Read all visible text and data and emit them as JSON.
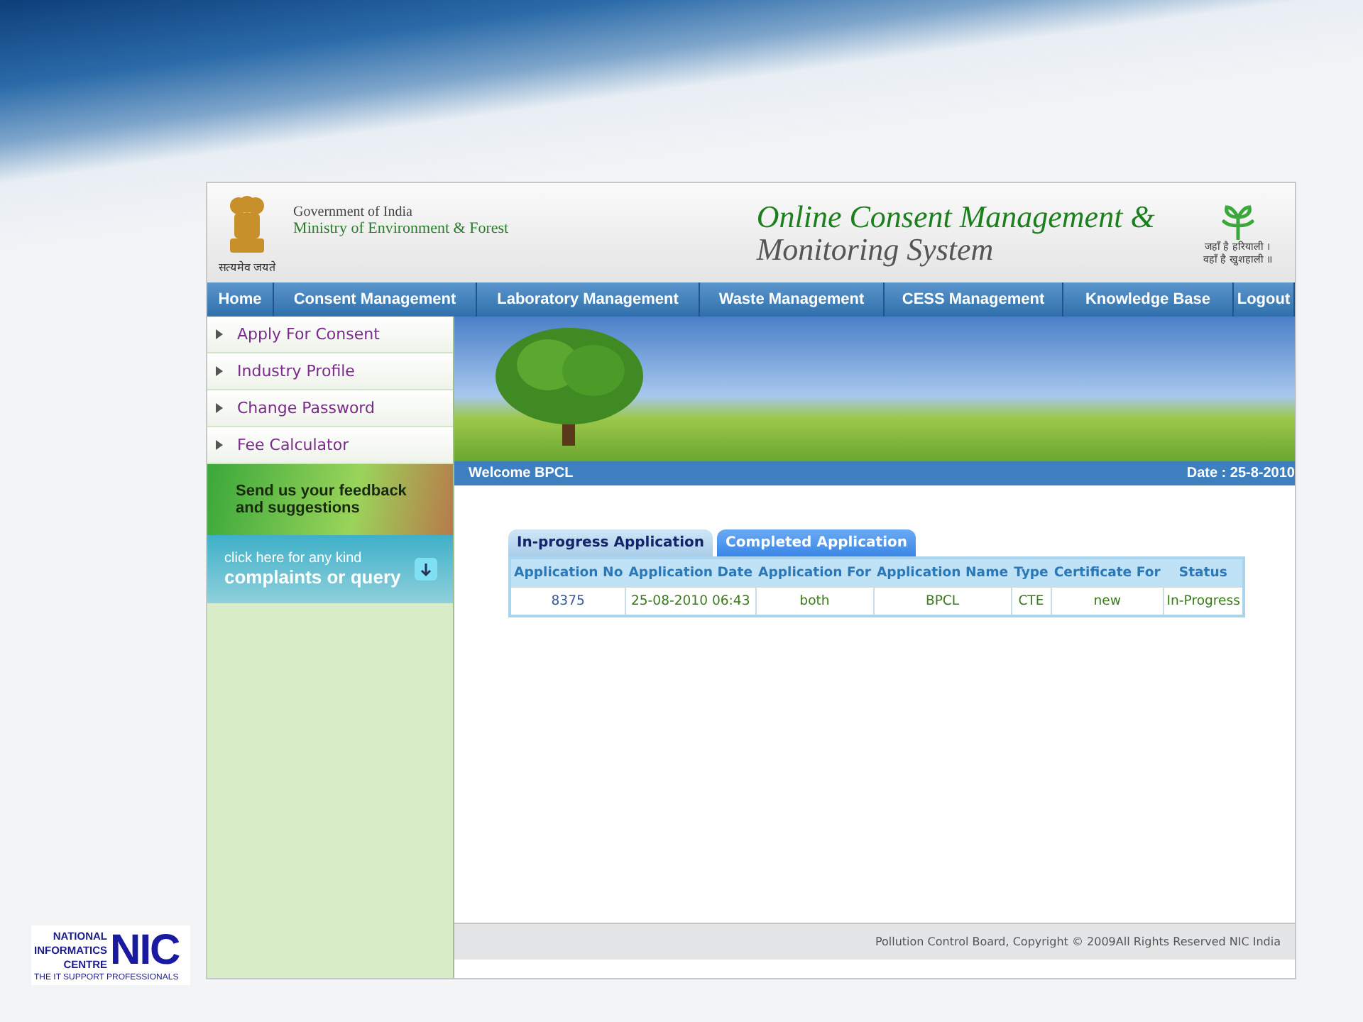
{
  "header": {
    "emblem_caption": "सत्यमेव जयते",
    "government": "Government of India",
    "ministry": "Ministry of Environment & Forest",
    "title_line1": "Online Consent Management &",
    "title_line2": "Monitoring System",
    "slogan_line1": "जहाँ है हरियाली ।",
    "slogan_line2": "वहाँ है खुशहाली ॥"
  },
  "nav": [
    "Home",
    "Consent Management",
    "Laboratory Management",
    "Waste Management",
    "CESS Management",
    "Knowledge Base",
    "Logout"
  ],
  "sidebar": {
    "items": [
      "Apply For Consent",
      "Industry Profile",
      "Change Password",
      "Fee Calculator"
    ],
    "feedback_banner": {
      "line1": "Send us your feedback",
      "line2": "and suggestions"
    },
    "complaints_banner": {
      "line1": "click here for any kind",
      "line2": "complaints or query"
    }
  },
  "welcome": "Welcome BPCL",
  "date": "Date : 25-8-2010",
  "tabs": [
    {
      "label": "In-progress Application",
      "selected": false
    },
    {
      "label": "Completed Application",
      "selected": true
    }
  ],
  "table": {
    "columns": [
      "Application No",
      "Application Date",
      "Application For",
      "Application Name",
      "Type",
      "Certificate For",
      "Status"
    ],
    "rows": [
      [
        "8375",
        "25-08-2010 06:43",
        "both",
        "BPCL",
        "CTE",
        "new",
        "In-Progress"
      ]
    ]
  },
  "footer": "Pollution Control Board, Copyright © 2009All Rights Reserved NIC India",
  "nic_logo": {
    "line1": "NATIONAL",
    "line2": "INFORMATICS",
    "line3": "CENTRE",
    "mark": "NIC",
    "tagline": "THE IT SUPPORT PROFESSIONALS"
  }
}
